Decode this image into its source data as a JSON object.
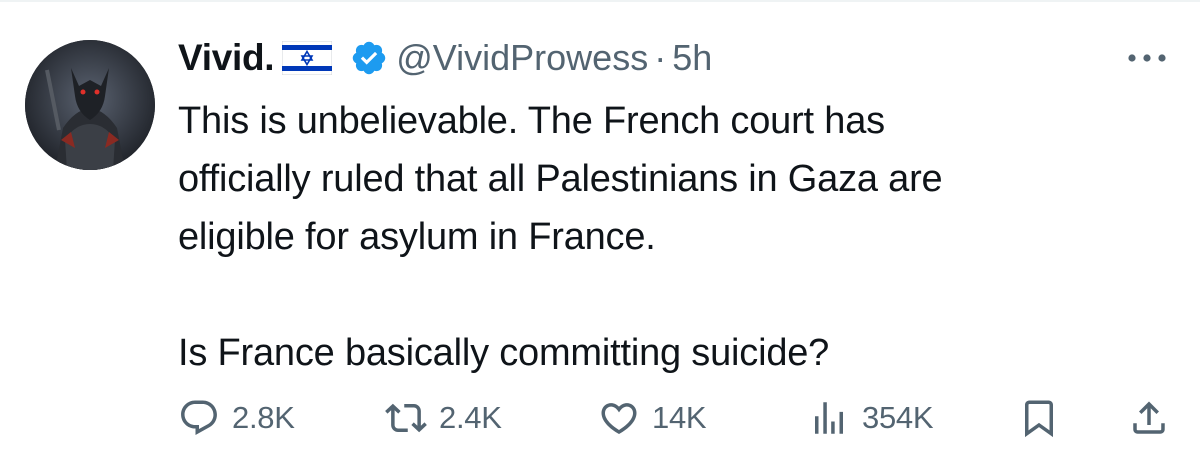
{
  "tweet": {
    "display_name": "Vivid.",
    "handle": "@VividProwess",
    "separator": "·",
    "time": "5h",
    "text_lines": [
      "This is unbelievable. The French court has",
      "officially ruled that all Palestinians in Gaza are",
      "eligible for asylum in France.",
      "Is France basically committing suicide?"
    ]
  },
  "actions": {
    "replies": "2.8K",
    "retweets": "2.4K",
    "likes": "14K",
    "views": "354K"
  },
  "colors": {
    "text": "#0f1419",
    "secondary": "#536471",
    "verified": "#1d9bf0",
    "flag_blue": "#0038b8"
  },
  "icons": [
    "flag-icon",
    "verified-badge-icon",
    "more-icon",
    "reply-icon",
    "retweet-icon",
    "like-icon",
    "views-icon",
    "bookmark-icon",
    "share-icon"
  ]
}
